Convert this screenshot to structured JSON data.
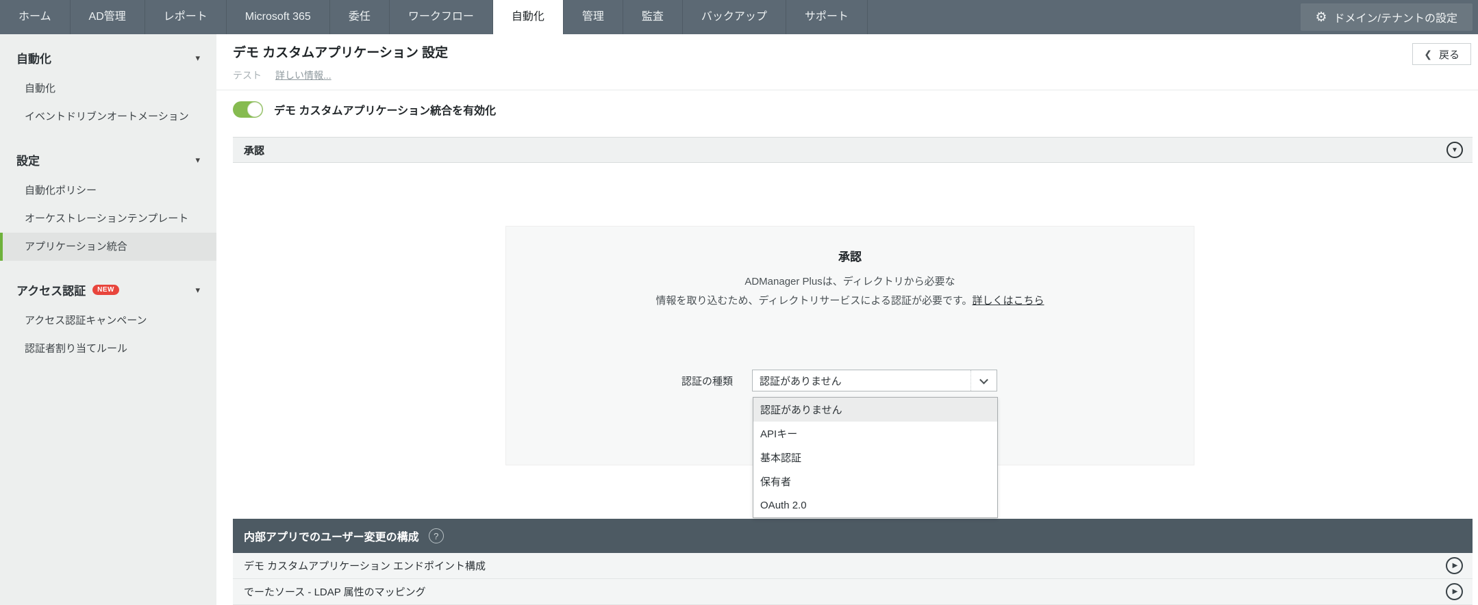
{
  "nav": {
    "tabs": [
      "ホーム",
      "AD管理",
      "レポート",
      "Microsoft 365",
      "委任",
      "ワークフロー",
      "自動化",
      "管理",
      "監査",
      "バックアップ",
      "サポート"
    ],
    "active_tab": "自動化",
    "settings_button": "ドメイン/テナントの設定"
  },
  "sidebar": {
    "sections": [
      {
        "title": "自動化",
        "items": [
          "自動化",
          "イベントドリブンオートメーション"
        ]
      },
      {
        "title": "設定",
        "items": [
          "自動化ポリシー",
          "オーケストレーションテンプレート",
          "アプリケーション統合"
        ]
      },
      {
        "title": "アクセス認証",
        "badge": "NEW",
        "items": [
          "アクセス認証キャンペーン",
          "認証者割り当てルール"
        ]
      }
    ],
    "selected_item": "アプリケーション統合"
  },
  "header": {
    "title": "デモ カスタムアプリケーション 設定",
    "subtitle": "テスト",
    "info_link": "詳しい情報...",
    "back_button": "戻る"
  },
  "toggle": {
    "label": "デモ カスタムアプリケーション統合を有効化",
    "state": "on"
  },
  "approval": {
    "bar_title": "承認",
    "panel_title": "承認",
    "description_line1": "ADManager Plusは、ディレクトリから必要な",
    "description_line2": "情報を取り込むため、ディレクトリサービスによる認証が必要です。",
    "link_text": "詳しくはこちら",
    "auth_label": "認証の種類",
    "auth_selected": "認証がありません",
    "auth_options": [
      "認証がありません",
      "APIキー",
      "基本認証",
      "保有者",
      "OAuth 2.0"
    ]
  },
  "bottom": {
    "bar_title": "内部アプリでのユーザー変更の構成",
    "rows": [
      "デモ カスタムアプリケーション エンドポイント構成",
      "でーたソース - LDAP 属性のマッピング"
    ]
  },
  "icons": {
    "gear": "⚙",
    "back_chevron": "❮",
    "section_caret": "▾",
    "collapse_caret": "▼",
    "play": "▶",
    "help": "?"
  },
  "colors": {
    "nav_bg": "#5c6974",
    "toggle_green": "#86bb50",
    "selected_green": "#6fb23c",
    "badge_red": "#e8453c",
    "dark_bar": "#4d5a63"
  }
}
